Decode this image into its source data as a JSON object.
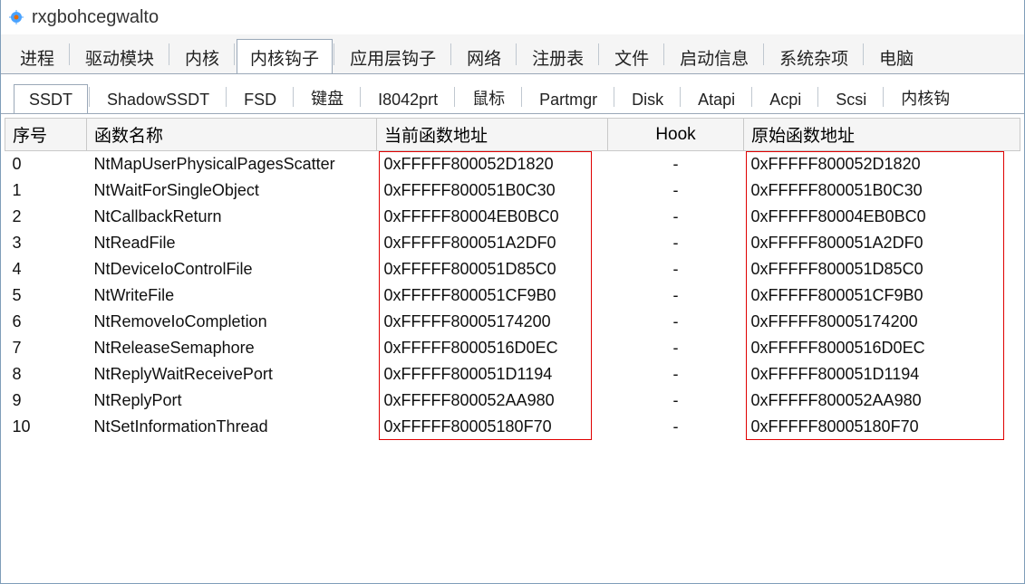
{
  "window": {
    "title": "rxgbohcegwalto"
  },
  "tabs_top": [
    {
      "label": "进程",
      "active": false
    },
    {
      "label": "驱动模块",
      "active": false
    },
    {
      "label": "内核",
      "active": false
    },
    {
      "label": "内核钩子",
      "active": true
    },
    {
      "label": "应用层钩子",
      "active": false
    },
    {
      "label": "网络",
      "active": false
    },
    {
      "label": "注册表",
      "active": false
    },
    {
      "label": "文件",
      "active": false
    },
    {
      "label": "启动信息",
      "active": false
    },
    {
      "label": "系统杂项",
      "active": false
    },
    {
      "label": "电脑",
      "active": false
    }
  ],
  "tabs_sub": [
    {
      "label": "SSDT",
      "active": true
    },
    {
      "label": "ShadowSSDT",
      "active": false
    },
    {
      "label": "FSD",
      "active": false
    },
    {
      "label": "键盘",
      "active": false
    },
    {
      "label": "I8042prt",
      "active": false
    },
    {
      "label": "鼠标",
      "active": false
    },
    {
      "label": "Partmgr",
      "active": false
    },
    {
      "label": "Disk",
      "active": false
    },
    {
      "label": "Atapi",
      "active": false
    },
    {
      "label": "Acpi",
      "active": false
    },
    {
      "label": "Scsi",
      "active": false
    },
    {
      "label": "内核钩",
      "active": false
    }
  ],
  "table": {
    "headers": {
      "index": "序号",
      "name": "函数名称",
      "current": "当前函数地址",
      "hook": "Hook",
      "original": "原始函数地址"
    },
    "rows": [
      {
        "index": "0",
        "name": "NtMapUserPhysicalPagesScatter",
        "current": "0xFFFFF800052D1820",
        "hook": "-",
        "original": "0xFFFFF800052D1820"
      },
      {
        "index": "1",
        "name": "NtWaitForSingleObject",
        "current": "0xFFFFF800051B0C30",
        "hook": "-",
        "original": "0xFFFFF800051B0C30"
      },
      {
        "index": "2",
        "name": "NtCallbackReturn",
        "current": "0xFFFFF80004EB0BC0",
        "hook": "-",
        "original": "0xFFFFF80004EB0BC0"
      },
      {
        "index": "3",
        "name": "NtReadFile",
        "current": "0xFFFFF800051A2DF0",
        "hook": "-",
        "original": "0xFFFFF800051A2DF0"
      },
      {
        "index": "4",
        "name": "NtDeviceIoControlFile",
        "current": "0xFFFFF800051D85C0",
        "hook": "-",
        "original": "0xFFFFF800051D85C0"
      },
      {
        "index": "5",
        "name": "NtWriteFile",
        "current": "0xFFFFF800051CF9B0",
        "hook": "-",
        "original": "0xFFFFF800051CF9B0"
      },
      {
        "index": "6",
        "name": "NtRemoveIoCompletion",
        "current": "0xFFFFF80005174200",
        "hook": "-",
        "original": "0xFFFFF80005174200"
      },
      {
        "index": "7",
        "name": "NtReleaseSemaphore",
        "current": "0xFFFFF8000516D0EC",
        "hook": "-",
        "original": "0xFFFFF8000516D0EC"
      },
      {
        "index": "8",
        "name": "NtReplyWaitReceivePort",
        "current": "0xFFFFF800051D1194",
        "hook": "-",
        "original": "0xFFFFF800051D1194"
      },
      {
        "index": "9",
        "name": "NtReplyPort",
        "current": "0xFFFFF800052AA980",
        "hook": "-",
        "original": "0xFFFFF800052AA980"
      },
      {
        "index": "10",
        "name": "NtSetInformationThread",
        "current": "0xFFFFF80005180F70",
        "hook": "-",
        "original": "0xFFFFF80005180F70"
      }
    ]
  }
}
